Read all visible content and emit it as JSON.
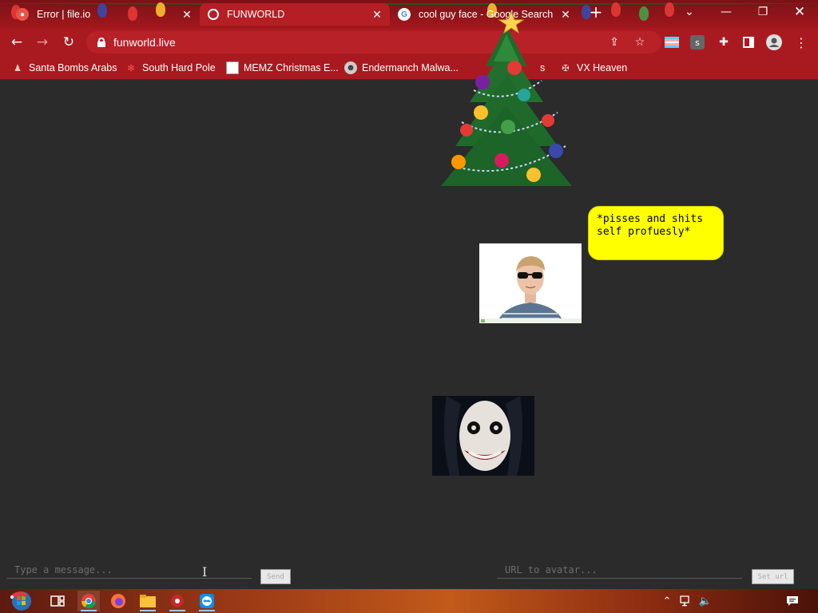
{
  "browser": {
    "tabs": [
      {
        "title": "Error | file.io",
        "favicon": "file-io-icon",
        "active": false
      },
      {
        "title": "FUNWORLD",
        "favicon": "globe-icon",
        "active": true
      },
      {
        "title": "cool guy face - Google Search",
        "favicon": "google-icon",
        "active": false
      }
    ],
    "new_tab_label": "+",
    "url": "funworld.live"
  },
  "bookmarks": [
    {
      "label": "Santa Bombs Arabs",
      "icon": "santa-icon"
    },
    {
      "label": "South Hard Pole",
      "icon": "snowflake-icon"
    },
    {
      "label": "MEMZ Christmas E...",
      "icon": "memz-icon"
    },
    {
      "label": "Endermanch Malwa...",
      "icon": "endermanch-icon"
    },
    {
      "label": "s",
      "icon": ""
    },
    {
      "label": "VX Heaven",
      "icon": "vx-heaven-icon"
    }
  ],
  "page": {
    "speech_bubble": "*pisses and shits self profuesly*",
    "message_input": {
      "placeholder": "Type a message..."
    },
    "send_button": "Send",
    "avatar_input": {
      "placeholder": "URL to avatar..."
    },
    "set_avatar_button": "Set url"
  },
  "taskbar": {
    "apps": [
      "start-orb",
      "task-view-icon",
      "chrome-icon",
      "firefox-icon",
      "file-explorer-icon",
      "app-icon",
      "teamviewer-icon"
    ],
    "tray": [
      "chevron-up-icon",
      "network-icon",
      "speaker-icon",
      "notification-icon"
    ]
  },
  "colors": {
    "page_bg": "#2b2b2b",
    "chrome_red": "#a91a20",
    "bubble_yellow": "#ffff00"
  }
}
